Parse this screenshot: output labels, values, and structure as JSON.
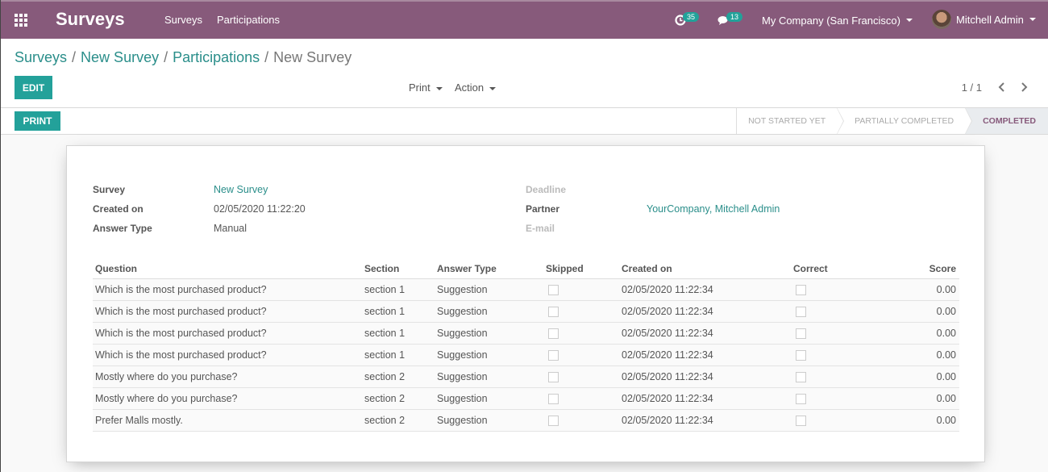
{
  "navbar": {
    "app_title": "Surveys",
    "menu": [
      "Surveys",
      "Participations"
    ],
    "activity_count": "35",
    "message_count": "13",
    "company": "My Company (San Francisco)",
    "user": "Mitchell Admin",
    "colors": {
      "brand": "#875a7b",
      "badge": "#22a29a"
    }
  },
  "breadcrumb": [
    "Surveys",
    "New Survey",
    "Participations"
  ],
  "breadcrumb_current": "New Survey",
  "control": {
    "edit_label": "EDIT",
    "print_label": "Print",
    "action_label": "Action",
    "pager": "1 / 1"
  },
  "statusbar": {
    "print_label": "PRINT",
    "stages": [
      "NOT STARTED YET",
      "PARTIALLY COMPLETED",
      "COMPLETED"
    ],
    "active_stage": "COMPLETED"
  },
  "form": {
    "left": [
      {
        "label": "Survey",
        "value": "New Survey"
      },
      {
        "label": "Created on",
        "value": "02/05/2020 11:22:20"
      },
      {
        "label": "Answer Type",
        "value": "Manual"
      }
    ],
    "right": [
      {
        "label": "Deadline",
        "value": ""
      },
      {
        "label": "Partner",
        "value": "YourCompany, Mitchell Admin"
      },
      {
        "label": "E-mail",
        "value": ""
      }
    ]
  },
  "table": {
    "columns": [
      "Question",
      "Section",
      "Answer Type",
      "Skipped",
      "Created on",
      "Correct",
      "Score"
    ],
    "rows": [
      {
        "question": "Which is the most purchased product?",
        "section": "section 1",
        "answer_type": "Suggestion",
        "skipped": false,
        "created_on": "02/05/2020 11:22:34",
        "correct": false,
        "score": "0.00"
      },
      {
        "question": "Which is the most purchased product?",
        "section": "section 1",
        "answer_type": "Suggestion",
        "skipped": false,
        "created_on": "02/05/2020 11:22:34",
        "correct": false,
        "score": "0.00"
      },
      {
        "question": "Which is the most purchased product?",
        "section": "section 1",
        "answer_type": "Suggestion",
        "skipped": false,
        "created_on": "02/05/2020 11:22:34",
        "correct": false,
        "score": "0.00"
      },
      {
        "question": "Which is the most purchased product?",
        "section": "section 1",
        "answer_type": "Suggestion",
        "skipped": false,
        "created_on": "02/05/2020 11:22:34",
        "correct": false,
        "score": "0.00"
      },
      {
        "question": "Mostly where do you purchase?",
        "section": "section 2",
        "answer_type": "Suggestion",
        "skipped": false,
        "created_on": "02/05/2020 11:22:34",
        "correct": false,
        "score": "0.00"
      },
      {
        "question": "Mostly where do you purchase?",
        "section": "section 2",
        "answer_type": "Suggestion",
        "skipped": false,
        "created_on": "02/05/2020 11:22:34",
        "correct": false,
        "score": "0.00"
      },
      {
        "question": "Prefer Malls mostly.",
        "section": "section 2",
        "answer_type": "Suggestion",
        "skipped": false,
        "created_on": "02/05/2020 11:22:34",
        "correct": false,
        "score": "0.00"
      }
    ]
  }
}
